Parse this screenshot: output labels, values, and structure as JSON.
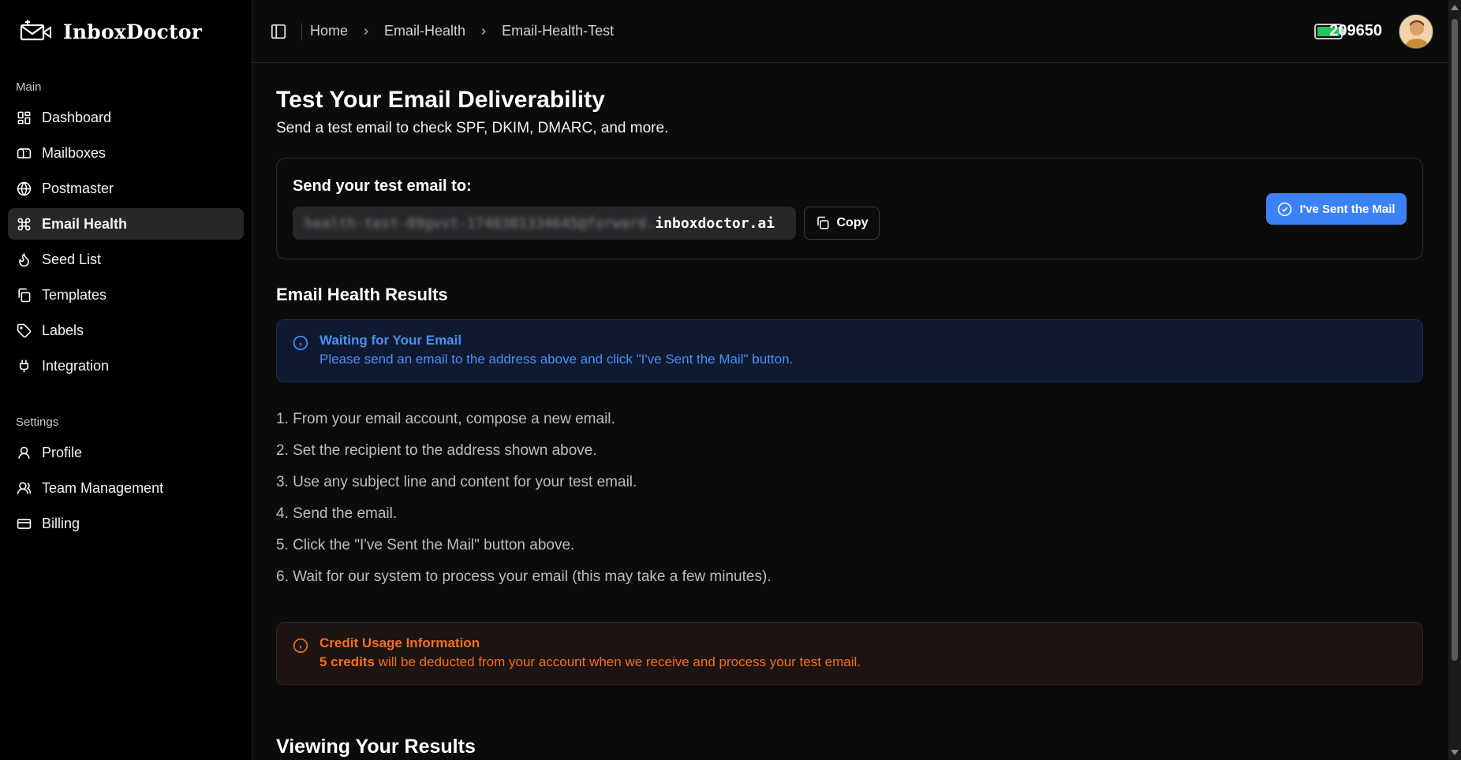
{
  "brand": {
    "name": "InboxDoctor"
  },
  "sidebar": {
    "main_label": "Main",
    "settings_label": "Settings",
    "main_items": [
      {
        "label": "Dashboard",
        "icon": "dashboard-icon"
      },
      {
        "label": "Mailboxes",
        "icon": "mailbox-icon"
      },
      {
        "label": "Postmaster",
        "icon": "globe-icon"
      },
      {
        "label": "Email Health",
        "icon": "command-icon",
        "active": true
      },
      {
        "label": "Seed List",
        "icon": "flame-icon"
      },
      {
        "label": "Templates",
        "icon": "copy-icon"
      },
      {
        "label": "Labels",
        "icon": "tag-icon"
      },
      {
        "label": "Integration",
        "icon": "plug-icon"
      }
    ],
    "settings_items": [
      {
        "label": "Profile",
        "icon": "user-icon"
      },
      {
        "label": "Team Management",
        "icon": "users-icon"
      },
      {
        "label": "Billing",
        "icon": "credit-card-icon"
      }
    ]
  },
  "topbar": {
    "breadcrumb": [
      "Home",
      "Email-Health",
      "Email-Health-Test"
    ],
    "credits": "209650"
  },
  "page": {
    "title": "Test Your Email Deliverability",
    "subtitle": "Send a test email to check SPF, DKIM, DMARC, and more."
  },
  "send_card": {
    "label": "Send your test email to:",
    "address_hidden": "health-test-09gvvt-1748381334645@forward.",
    "address_domain": "inboxdoctor.ai",
    "copy_label": "Copy",
    "sent_label": "I've Sent the Mail"
  },
  "results": {
    "title": "Email Health Results",
    "info_title": "Waiting for Your Email",
    "info_body": "Please send an email to the address above and click \"I've Sent the Mail\" button.",
    "steps": [
      "1. From your email account, compose a new email.",
      "2. Set the recipient to the address shown above.",
      "3. Use any subject line and content for your test email.",
      "4. Send the email.",
      "5. Click the \"I've Sent the Mail\" button above.",
      "6. Wait for our system to process your email (this may take a few minutes)."
    ],
    "credit_title": "Credit Usage Information",
    "credit_amount": "5 credits",
    "credit_body": " will be deducted from your account when we receive and process your test email."
  },
  "viewing": {
    "title": "Viewing Your Results"
  },
  "colors": {
    "accent": "#3b82f6",
    "info": "#4b8ff7",
    "warning": "#f2701e",
    "battery": "#22c55e"
  }
}
